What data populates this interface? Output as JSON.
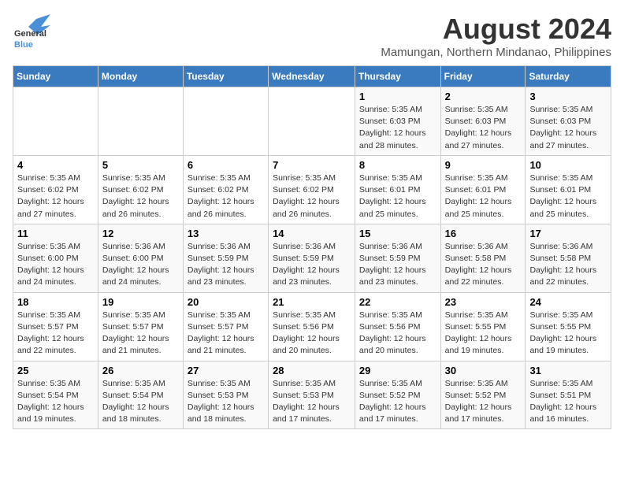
{
  "header": {
    "logo_line1": "General",
    "logo_line2": "Blue",
    "month_year": "August 2024",
    "location": "Mamungan, Northern Mindanao, Philippines"
  },
  "days_of_week": [
    "Sunday",
    "Monday",
    "Tuesday",
    "Wednesday",
    "Thursday",
    "Friday",
    "Saturday"
  ],
  "weeks": [
    [
      {
        "day": "",
        "info": ""
      },
      {
        "day": "",
        "info": ""
      },
      {
        "day": "",
        "info": ""
      },
      {
        "day": "",
        "info": ""
      },
      {
        "day": "1",
        "info": "Sunrise: 5:35 AM\nSunset: 6:03 PM\nDaylight: 12 hours\nand 28 minutes."
      },
      {
        "day": "2",
        "info": "Sunrise: 5:35 AM\nSunset: 6:03 PM\nDaylight: 12 hours\nand 27 minutes."
      },
      {
        "day": "3",
        "info": "Sunrise: 5:35 AM\nSunset: 6:03 PM\nDaylight: 12 hours\nand 27 minutes."
      }
    ],
    [
      {
        "day": "4",
        "info": "Sunrise: 5:35 AM\nSunset: 6:02 PM\nDaylight: 12 hours\nand 27 minutes."
      },
      {
        "day": "5",
        "info": "Sunrise: 5:35 AM\nSunset: 6:02 PM\nDaylight: 12 hours\nand 26 minutes."
      },
      {
        "day": "6",
        "info": "Sunrise: 5:35 AM\nSunset: 6:02 PM\nDaylight: 12 hours\nand 26 minutes."
      },
      {
        "day": "7",
        "info": "Sunrise: 5:35 AM\nSunset: 6:02 PM\nDaylight: 12 hours\nand 26 minutes."
      },
      {
        "day": "8",
        "info": "Sunrise: 5:35 AM\nSunset: 6:01 PM\nDaylight: 12 hours\nand 25 minutes."
      },
      {
        "day": "9",
        "info": "Sunrise: 5:35 AM\nSunset: 6:01 PM\nDaylight: 12 hours\nand 25 minutes."
      },
      {
        "day": "10",
        "info": "Sunrise: 5:35 AM\nSunset: 6:01 PM\nDaylight: 12 hours\nand 25 minutes."
      }
    ],
    [
      {
        "day": "11",
        "info": "Sunrise: 5:35 AM\nSunset: 6:00 PM\nDaylight: 12 hours\nand 24 minutes."
      },
      {
        "day": "12",
        "info": "Sunrise: 5:36 AM\nSunset: 6:00 PM\nDaylight: 12 hours\nand 24 minutes."
      },
      {
        "day": "13",
        "info": "Sunrise: 5:36 AM\nSunset: 5:59 PM\nDaylight: 12 hours\nand 23 minutes."
      },
      {
        "day": "14",
        "info": "Sunrise: 5:36 AM\nSunset: 5:59 PM\nDaylight: 12 hours\nand 23 minutes."
      },
      {
        "day": "15",
        "info": "Sunrise: 5:36 AM\nSunset: 5:59 PM\nDaylight: 12 hours\nand 23 minutes."
      },
      {
        "day": "16",
        "info": "Sunrise: 5:36 AM\nSunset: 5:58 PM\nDaylight: 12 hours\nand 22 minutes."
      },
      {
        "day": "17",
        "info": "Sunrise: 5:36 AM\nSunset: 5:58 PM\nDaylight: 12 hours\nand 22 minutes."
      }
    ],
    [
      {
        "day": "18",
        "info": "Sunrise: 5:35 AM\nSunset: 5:57 PM\nDaylight: 12 hours\nand 22 minutes."
      },
      {
        "day": "19",
        "info": "Sunrise: 5:35 AM\nSunset: 5:57 PM\nDaylight: 12 hours\nand 21 minutes."
      },
      {
        "day": "20",
        "info": "Sunrise: 5:35 AM\nSunset: 5:57 PM\nDaylight: 12 hours\nand 21 minutes."
      },
      {
        "day": "21",
        "info": "Sunrise: 5:35 AM\nSunset: 5:56 PM\nDaylight: 12 hours\nand 20 minutes."
      },
      {
        "day": "22",
        "info": "Sunrise: 5:35 AM\nSunset: 5:56 PM\nDaylight: 12 hours\nand 20 minutes."
      },
      {
        "day": "23",
        "info": "Sunrise: 5:35 AM\nSunset: 5:55 PM\nDaylight: 12 hours\nand 19 minutes."
      },
      {
        "day": "24",
        "info": "Sunrise: 5:35 AM\nSunset: 5:55 PM\nDaylight: 12 hours\nand 19 minutes."
      }
    ],
    [
      {
        "day": "25",
        "info": "Sunrise: 5:35 AM\nSunset: 5:54 PM\nDaylight: 12 hours\nand 19 minutes."
      },
      {
        "day": "26",
        "info": "Sunrise: 5:35 AM\nSunset: 5:54 PM\nDaylight: 12 hours\nand 18 minutes."
      },
      {
        "day": "27",
        "info": "Sunrise: 5:35 AM\nSunset: 5:53 PM\nDaylight: 12 hours\nand 18 minutes."
      },
      {
        "day": "28",
        "info": "Sunrise: 5:35 AM\nSunset: 5:53 PM\nDaylight: 12 hours\nand 17 minutes."
      },
      {
        "day": "29",
        "info": "Sunrise: 5:35 AM\nSunset: 5:52 PM\nDaylight: 12 hours\nand 17 minutes."
      },
      {
        "day": "30",
        "info": "Sunrise: 5:35 AM\nSunset: 5:52 PM\nDaylight: 12 hours\nand 17 minutes."
      },
      {
        "day": "31",
        "info": "Sunrise: 5:35 AM\nSunset: 5:51 PM\nDaylight: 12 hours\nand 16 minutes."
      }
    ]
  ]
}
